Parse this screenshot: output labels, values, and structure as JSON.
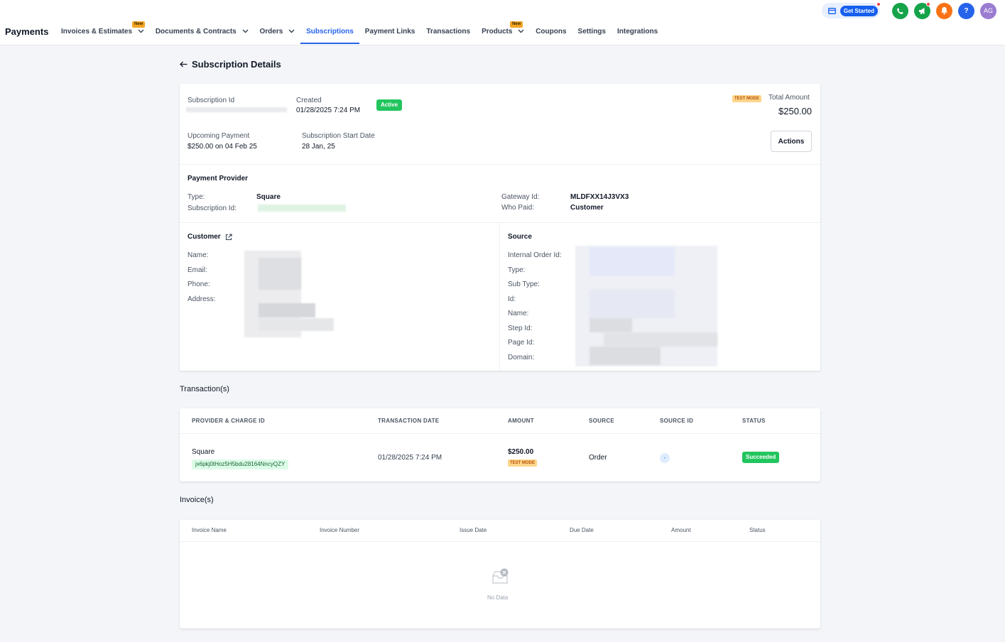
{
  "header": {
    "app_title": "Payments",
    "nav": [
      {
        "label": "Invoices & Estimates",
        "badge": "New",
        "dropdown": true
      },
      {
        "label": "Documents & Contracts",
        "dropdown": true
      },
      {
        "label": "Orders",
        "dropdown": true
      },
      {
        "label": "Subscriptions",
        "active": true
      },
      {
        "label": "Payment Links"
      },
      {
        "label": "Transactions"
      },
      {
        "label": "Products",
        "badge": "New",
        "dropdown": true
      },
      {
        "label": "Coupons"
      },
      {
        "label": "Settings"
      },
      {
        "label": "Integrations"
      }
    ],
    "get_started": "Get Started",
    "avatar_initials": "AG",
    "help_glyph": "?"
  },
  "page": {
    "title": "Subscription Details"
  },
  "summary": {
    "subscription_id_label": "Subscription Id",
    "created_label": "Created",
    "created_value": "01/28/2025 7:24 PM",
    "status": "Active",
    "test_mode": "TEST MODE",
    "total_amount_label": "Total Amount",
    "total_amount": "$250.00",
    "upcoming_label": "Upcoming Payment",
    "upcoming_value": "$250.00 on 04 Feb 25",
    "start_date_label": "Subscription Start Date",
    "start_date_value": "28 Jan, 25",
    "actions_label": "Actions"
  },
  "provider": {
    "title": "Payment Provider",
    "type_label": "Type:",
    "type_value": "Square",
    "sub_id_label": "Subscription Id:",
    "gateway_label": "Gateway Id:",
    "gateway_value": "MLDFXX14J3VX3",
    "who_paid_label": "Who Paid:",
    "who_paid_value": "Customer"
  },
  "customer": {
    "title": "Customer",
    "fields": [
      "Name:",
      "Email:",
      "Phone:",
      "Address:"
    ]
  },
  "source": {
    "title": "Source",
    "fields": [
      "Internal Order Id:",
      "Type:",
      "Sub Type:",
      "Id:",
      "Name:",
      "Step Id:",
      "Page Id:",
      "Domain:"
    ]
  },
  "transactions": {
    "title": "Transaction(s)",
    "headers": [
      "Provider & Charge Id",
      "Transaction Date",
      "Amount",
      "Source",
      "Source Id",
      "Status"
    ],
    "rows": [
      {
        "provider": "Square",
        "charge_id": "jx6pkj0tHoz5H5bdu28164NncyQZY",
        "date": "01/28/2025 7:24 PM",
        "amount": "$250.00",
        "test_mode": "TEST MODE",
        "source": "Order",
        "source_id": "-",
        "status": "Succeeded"
      }
    ]
  },
  "invoices": {
    "title": "Invoice(s)",
    "headers": [
      "Invoice Name",
      "Invoice Number",
      "Issue Date",
      "Due Date",
      "Amount",
      "Status"
    ],
    "empty_text": "No Data"
  },
  "colors": {
    "accent": "#2563eb",
    "success": "#22c55e",
    "test_mode": "#ffd58a"
  }
}
